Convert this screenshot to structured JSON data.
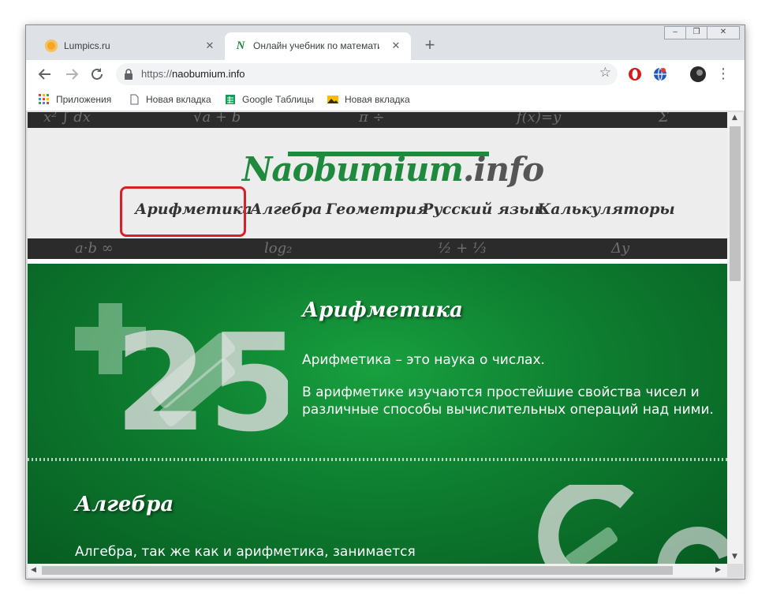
{
  "browser": {
    "tabs": [
      {
        "title": "Lumpics.ru",
        "favicon": "lumpics-favicon"
      },
      {
        "title": "Онлайн учебник по математике",
        "favicon": "naobumium-favicon"
      }
    ],
    "new_tab_symbol": "+",
    "url_scheme": "https://",
    "url_host": "naobumium.info",
    "bookmarks": [
      {
        "label": "Приложения",
        "icon": "apps-grid-icon"
      },
      {
        "label": "Новая вкладка",
        "icon": "page-icon"
      },
      {
        "label": "Google Таблицы",
        "icon": "sheets-icon"
      },
      {
        "label": "Новая вкладка",
        "icon": "image-icon"
      }
    ]
  },
  "site": {
    "logo_main": "Naobumium",
    "logo_domain": ".info",
    "nav": [
      "Арифметика",
      "Алгебра",
      "Геометрия",
      "Русский язык",
      "Калькуляторы"
    ],
    "highlighted_nav": "Арифметика",
    "sections": [
      {
        "title": "Арифметика",
        "paragraphs": [
          "Арифметика – это наука о числах.",
          "В арифметике изучаются простейшие свойства чисел и различные способы вычислительных операций над ними."
        ]
      },
      {
        "title": "Алгебра",
        "paragraphs": [
          "Алгебра, так же как и арифметика, занимается"
        ]
      }
    ]
  },
  "colors": {
    "brand_green": "#1f8a3e",
    "highlight_red": "#d6202a",
    "content_bg": "#0e7d30"
  }
}
